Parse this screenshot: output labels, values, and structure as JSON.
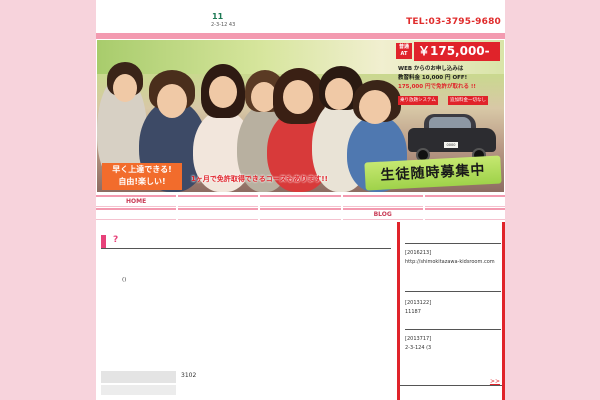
{
  "header": {
    "title": "11",
    "subtitle": "2-3-12 43",
    "tel": "TEL:03-3795-9680"
  },
  "hero": {
    "promo_tag": "普通AT",
    "promo_price": "￥175,000-",
    "promo_line1": "WEB からのお申し込みは",
    "promo_line2": "教習料金 10,000 円 OFF!",
    "promo_line3": "175,000 円で免許が取れる !!",
    "chip1": "乗り放題システム",
    "chip2": "追加料金一切なし",
    "plate": "0000",
    "bubble_line1": "早く上達できる!",
    "bubble_line2": "自由!楽しい!",
    "caption": "1ヶ月で免許取得できるコースもあります!!",
    "recruit": "生徒随時募集中"
  },
  "nav": {
    "row1": [
      "HOME",
      "",
      "",
      "",
      ""
    ],
    "row2": [
      "",
      "",
      "",
      "BLOG",
      ""
    ]
  },
  "main": {
    "post_title": "?",
    "body_text": "()",
    "gray_label": "3102"
  },
  "sidebar": {
    "items": [
      {
        "date": "[2016213]",
        "text": "http://shimokitazawa-kidsroom.com"
      },
      {
        "date": "[2013122]",
        "text": "11187"
      },
      {
        "date": "[2013717]",
        "text": "2-3-124 (3"
      }
    ],
    "more": ">>"
  }
}
